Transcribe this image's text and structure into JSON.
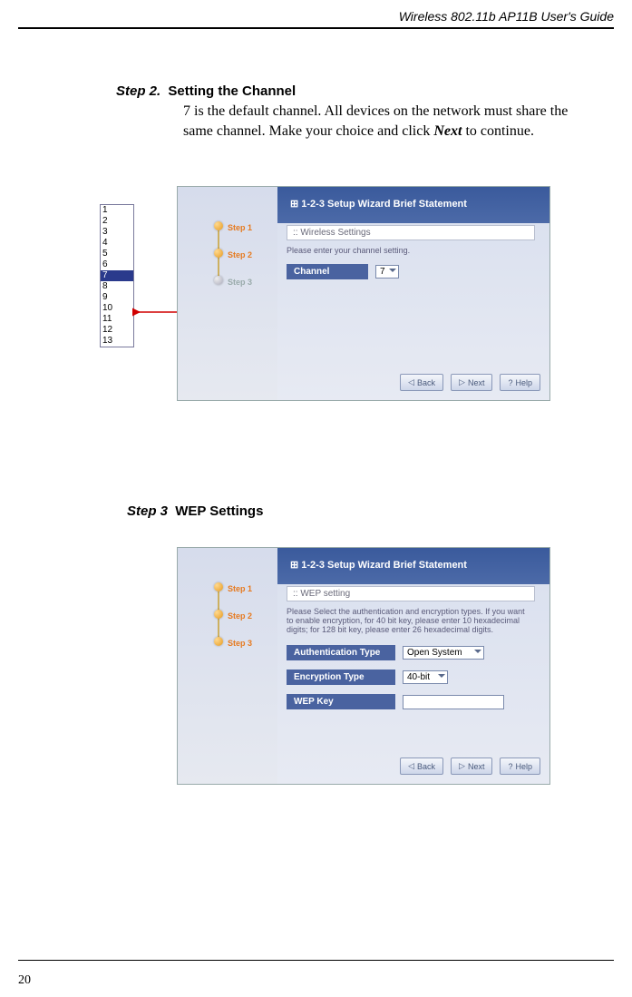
{
  "header": {
    "title": "Wireless 802.11b AP11B User's Guide"
  },
  "page_number": "20",
  "step2": {
    "label": "Step 2.",
    "title": "Setting the Channel",
    "text_before_bold": "7 is the default channel.  All devices on the network must share the same channel.  Make your choice and click ",
    "bold_word": "Next",
    "text_after_bold": " to continue."
  },
  "channel_list": {
    "options": [
      "1",
      "2",
      "3",
      "4",
      "5",
      "6",
      "7",
      "8",
      "9",
      "10",
      "11",
      "12",
      "13"
    ],
    "selected": "7"
  },
  "wizard_common": {
    "banner_icon_prefix": "⊞",
    "banner": "1-2-3 Setup Wizard Brief Statement",
    "steps": {
      "s1": "Step 1",
      "s2": "Step 2",
      "s3": "Step 3"
    },
    "buttons": {
      "back": "Back",
      "next": "Next",
      "help": "Help",
      "back_glyph": "◁",
      "next_glyph": "▷",
      "help_glyph": "?"
    }
  },
  "wizard_step2": {
    "section_title": ":: Wireless Settings",
    "instruction": "Please enter your channel setting.",
    "channel_label": "Channel",
    "channel_value": "7"
  },
  "step3": {
    "label": "Step 3",
    "title": "WEP Settings"
  },
  "wizard_step3": {
    "section_title": ":: WEP setting",
    "instruction": "Please Select the authentication and encryption types. If you want to enable encryption, for 40 bit key, please enter 10 hexadecimal digits; for 128 bit key, please enter 26 hexadecimal digits.",
    "auth_label": "Authentication Type",
    "auth_value": "Open System",
    "enc_label": "Encryption Type",
    "enc_value": "40-bit",
    "wepkey_label": "WEP Key",
    "wepkey_value": ""
  }
}
